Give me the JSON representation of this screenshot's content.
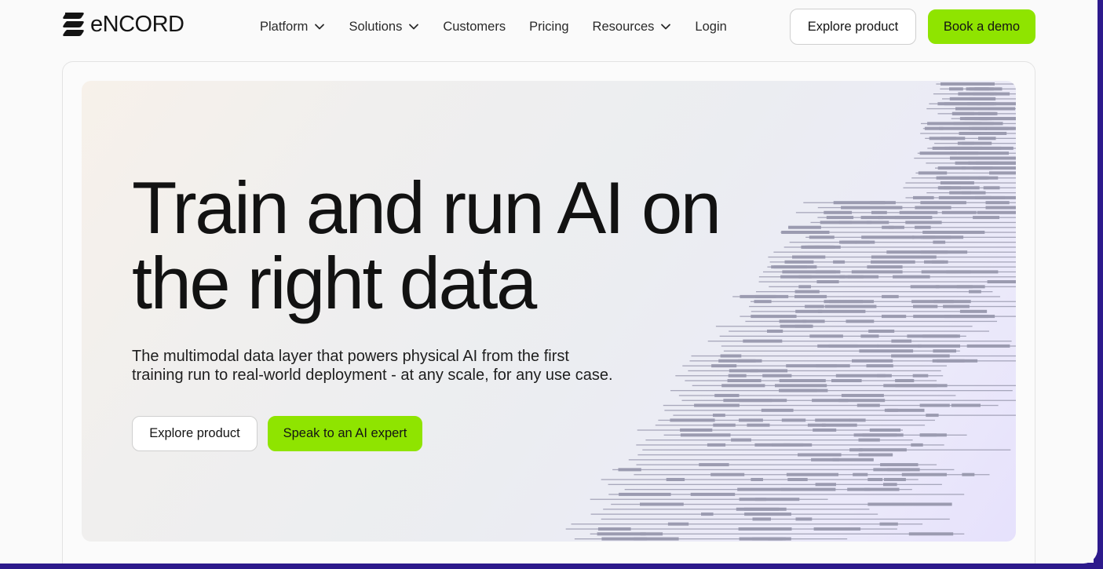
{
  "header": {
    "logo_text": "eNCORD",
    "nav": [
      {
        "label": "Platform",
        "dropdown": true
      },
      {
        "label": "Solutions",
        "dropdown": true
      },
      {
        "label": "Customers",
        "dropdown": false
      },
      {
        "label": "Pricing",
        "dropdown": false
      },
      {
        "label": "Resources",
        "dropdown": true
      },
      {
        "label": "Login",
        "dropdown": false
      }
    ],
    "explore_label": "Explore product",
    "demo_label": "Book a demo"
  },
  "hero": {
    "headline_line1": "Train and run AI on",
    "headline_line2": "the right data",
    "subtext_line1": "The multimodal data layer that powers physical AI from the first",
    "subtext_line2": "training run to real-world deployment - at any scale, for any use case.",
    "explore_label": "Explore product",
    "speak_label": "Speak to an AI expert"
  },
  "colors": {
    "accent_green": "#8fe400",
    "frame_purple": "#2d1a8c",
    "art_gray": "#9b9bb0"
  },
  "icons": {
    "chevron": "chevron-down-icon",
    "logo": "encord-logo-icon"
  }
}
